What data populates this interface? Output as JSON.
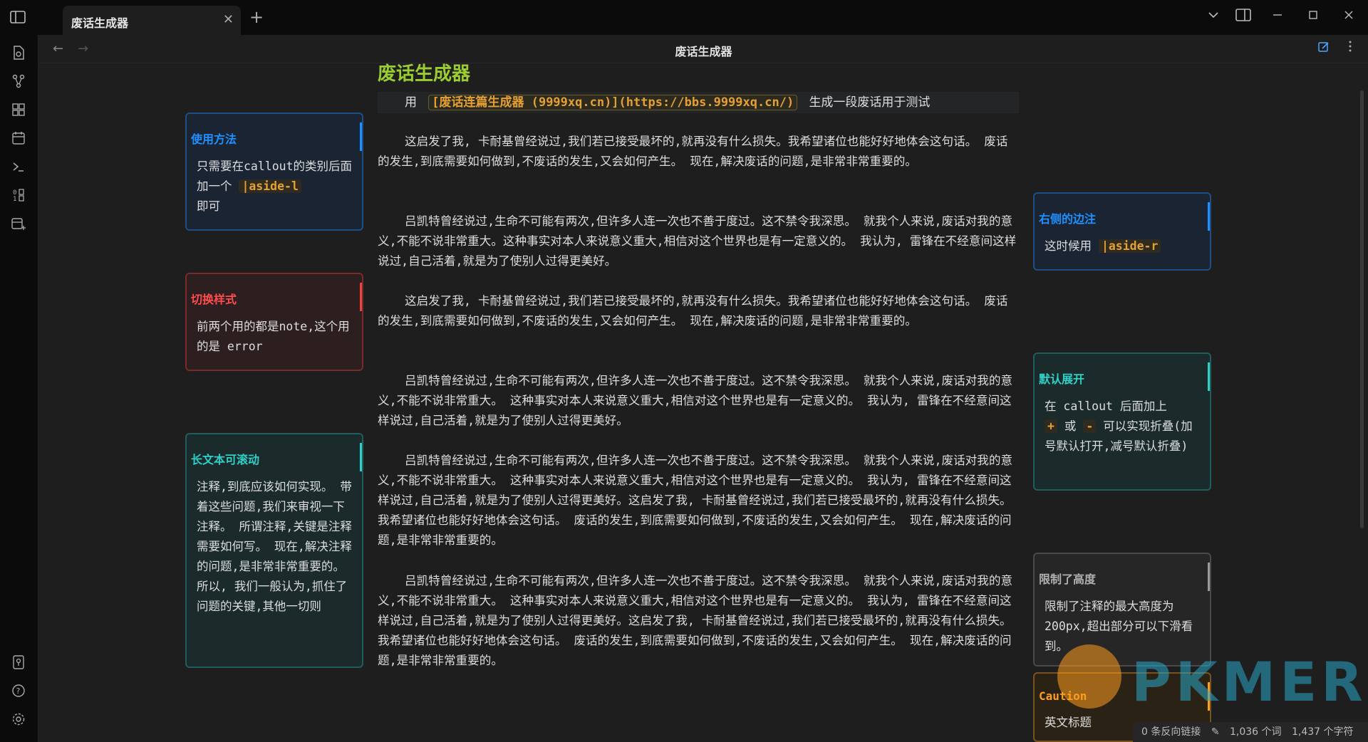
{
  "window": {
    "tab_title": "废话生成器",
    "close_glyph": "✕",
    "new_tab_glyph": "+"
  },
  "header": {
    "title": "废话生成器",
    "back_glyph": "←",
    "forward_glyph": "→"
  },
  "ribbon": {
    "icons": [
      "file-switcher-icon",
      "graph-icon",
      "canvas-icon",
      "calendar-icon",
      "terminal-icon",
      "outline-icon",
      "templates-icon",
      "vault-switcher-icon",
      "help-icon",
      "settings-icon"
    ]
  },
  "doc": {
    "heading": "废话生成器",
    "lead_prefix": "用",
    "lead_link": "[废话连篇生成器 (9999xq.cn)](https://bbs.9999xq.cn/)",
    "lead_suffix": "生成一段废话用于测试",
    "paragraphs": [
      "这启发了我, 卡耐基曾经说过,我们若已接受最坏的,就再没有什么损失。我希望诸位也能好好地体会这句话。 废话的发生,到底需要如何做到,不废话的发生,又会如何产生。 现在,解决废话的问题,是非常非常重要的。",
      "吕凯特曾经说过,生命不可能有两次,但许多人连一次也不善于度过。这不禁令我深思。 就我个人来说,废话对我的意义,不能不说非常重大。这种事实对本人来说意义重大,相信对这个世界也是有一定意义的。 我认为, 雷锋在不经意间这样说过,自己活着,就是为了使别人过得更美好。",
      "这启发了我, 卡耐基曾经说过,我们若已接受最坏的,就再没有什么损失。我希望诸位也能好好地体会这句话。 废话的发生,到底需要如何做到,不废话的发生,又会如何产生。 现在,解决废话的问题,是非常非常重要的。",
      "吕凯特曾经说过,生命不可能有两次,但许多人连一次也不善于度过。这不禁令我深思。 就我个人来说,废话对我的意义,不能不说非常重大。 这种事实对本人来说意义重大,相信对这个世界也是有一定意义的。 我认为, 雷锋在不经意间这样说过,自己活着,就是为了使别人过得更美好。",
      "吕凯特曾经说过,生命不可能有两次,但许多人连一次也不善于度过。这不禁令我深思。 就我个人来说,废话对我的意义,不能不说非常重大。 这种事实对本人来说意义重大,相信对这个世界也是有一定意义的。 我认为, 雷锋在不经意间这样说过,自己活着,就是为了使别人过得更美好。这启发了我, 卡耐基曾经说过,我们若已接受最坏的,就再没有什么损失。我希望诸位也能好好地体会这句话。 废话的发生,到底需要如何做到,不废话的发生,又会如何产生。 现在,解决废话的问题,是非常非常重要的。",
      "吕凯特曾经说过,生命不可能有两次,但许多人连一次也不善于度过。这不禁令我深思。 就我个人来说,废话对我的意义,不能不说非常重大。 这种事实对本人来说意义重大,相信对这个世界也是有一定意义的。 我认为, 雷锋在不经意间这样说过,自己活着,就是为了使别人过得更美好。这启发了我, 卡耐基曾经说过,我们若已接受最坏的,就再没有什么损失。我希望诸位也能好好地体会这句话。 废话的发生,到底需要如何做到,不废话的发生,又会如何产生。 现在,解决废话的问题,是非常非常重要的。"
    ]
  },
  "callouts_left": {
    "usage": {
      "title": "使用方法",
      "body_pre": "只需要在callout的类别后面加一个",
      "chip": "|aside-l",
      "body_post": "即可"
    },
    "switch": {
      "title": "切换样式",
      "body": "前两个用的都是note,这个用的是 error"
    },
    "scroll": {
      "title": "长文本可滚动",
      "body": "注释,到底应该如何实现。 带着这些问题,我们来审视一下注释。 所谓注释,关键是注释需要如何写。 现在,解决注释的问题,是非常非常重要的。 所以, 我们一般认为,抓住了问题的关键,其他一切则"
    }
  },
  "callouts_right": {
    "margin": {
      "title": "右侧的边注",
      "body_pre": "这时候用",
      "chip": "|aside-r"
    },
    "fold": {
      "title": "默认展开",
      "body_pre": "在 callout 后面加上",
      "chip_plus": "+",
      "mid": "或",
      "chip_minus": "-",
      "body_post": "可以实现折叠(加号默认打开,减号默认折叠)"
    },
    "limit": {
      "title": "限制了高度",
      "body": "限制了注释的最大高度为200px,超出部分可以下滑看到。"
    },
    "caution": {
      "title": "Caution",
      "body": "英文标题"
    }
  },
  "status": {
    "backlinks": "0 条反向链接",
    "words": "1,036 个词",
    "chars": "1,437 个字符"
  },
  "watermark": {
    "text": "PKMER"
  },
  "colors": {
    "heading": "#9acd32",
    "accent_link": "#e5a034",
    "note_blue": "#1e90ff",
    "error_red": "#ff4d4d",
    "cyan": "#2ed0c7",
    "caution_orange": "#ff9d1e"
  }
}
